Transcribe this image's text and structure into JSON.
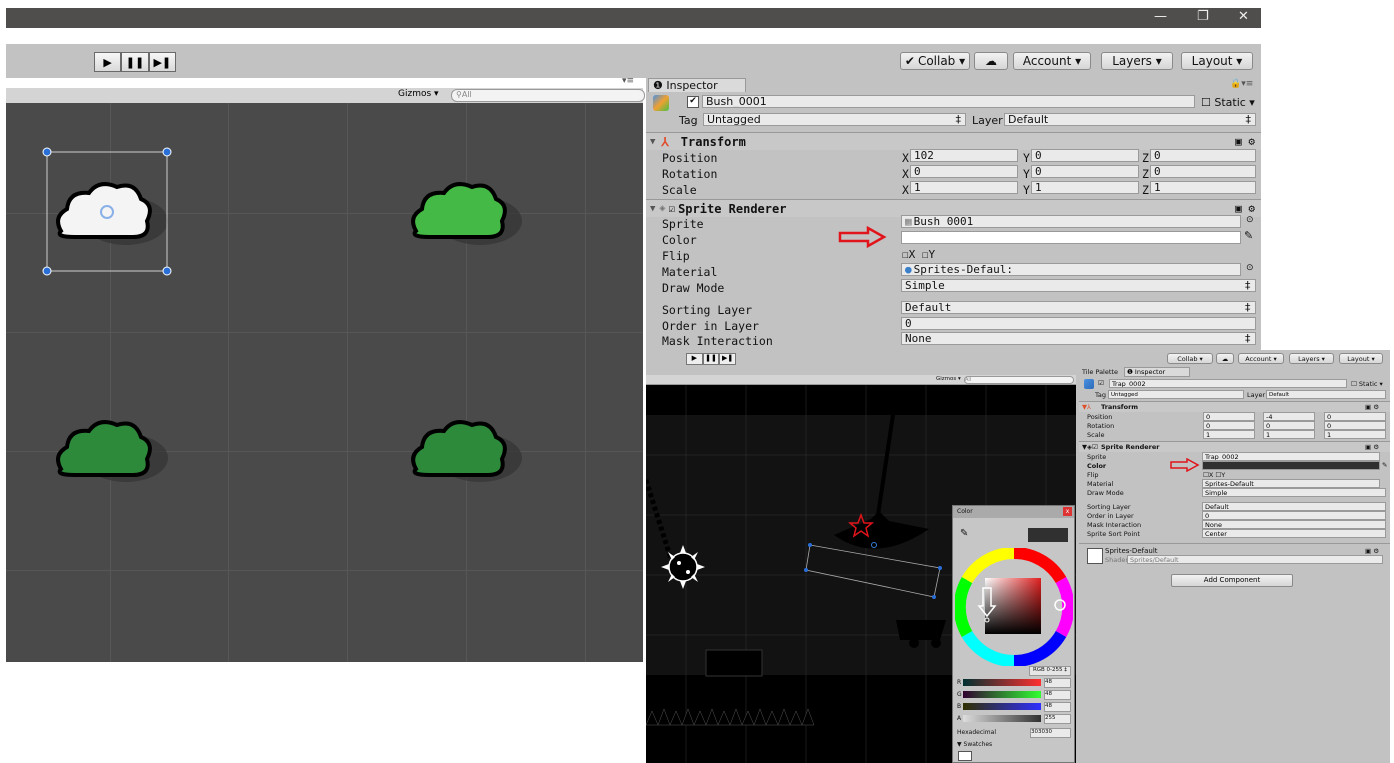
{
  "window_controls": {
    "minimize": "—",
    "restore": "❐",
    "close": "✕"
  },
  "toolbar": {
    "collab": "Collab ▾",
    "account": "Account ▾",
    "layers": "Layers ▾",
    "layout": "Layout ▾"
  },
  "scene": {
    "gizmos": "Gizmos ▾",
    "search_placeholder": "All"
  },
  "inspector": {
    "tab": "Inspector",
    "object_name": "Bush_0001",
    "static_label": "Static ▾",
    "tag_label": "Tag",
    "tag_value": "Untagged",
    "layer_label": "Layer",
    "layer_value": "Default",
    "transform": {
      "title": "Transform",
      "position_label": "Position",
      "pos": {
        "x": "102",
        "y": "0",
        "z": "0"
      },
      "rotation_label": "Rotation",
      "rot": {
        "x": "0",
        "y": "0",
        "z": "0"
      },
      "scale_label": "Scale",
      "scale": {
        "x": "1",
        "y": "1",
        "z": "1"
      }
    },
    "sprite_renderer": {
      "title": "Sprite Renderer",
      "sprite_label": "Sprite",
      "sprite_value": "Bush_0001",
      "color_label": "Color",
      "color_value": "#ffffff",
      "flip_label": "Flip",
      "flip_x": "X",
      "flip_y": "Y",
      "material_label": "Material",
      "material_value": "Sprites-Defaul:",
      "draw_mode_label": "Draw Mode",
      "draw_mode_value": "Simple",
      "sorting_layer_label": "Sorting Layer",
      "sorting_layer_value": "Default",
      "order_label": "Order in Layer",
      "order_value": "0",
      "mask_label": "Mask Interaction",
      "mask_value": "None"
    },
    "axis": {
      "x": "X",
      "y": "Y",
      "z": "Z"
    }
  },
  "second": {
    "toolbar": {
      "collab": "Collab ▾",
      "account": "Account ▾",
      "layers": "Layers ▾",
      "layout": "Layout ▾"
    },
    "gizmos": "Gizmos ▾",
    "search_placeholder": "All",
    "tabs": {
      "tile_palette": "Tile Palette",
      "inspector": "Inspector"
    },
    "object_name": "Trap_0002",
    "static_label": "Static ▾",
    "tag_label": "Tag",
    "tag_value": "Untagged",
    "layer_label": "Layer",
    "layer_value": "Default",
    "transform": {
      "title": "Transform",
      "position_label": "Position",
      "pos": {
        "x": "0",
        "y": "-4",
        "z": "0"
      },
      "rotation_label": "Rotation",
      "rot": {
        "x": "0",
        "y": "0",
        "z": "0"
      },
      "scale_label": "Scale",
      "scale": {
        "x": "1",
        "y": "1",
        "z": "1"
      }
    },
    "sprite_renderer": {
      "title": "Sprite Renderer",
      "sprite_label": "Sprite",
      "sprite_value": "Trap_0002",
      "color_label": "Color",
      "color_value": "#303030",
      "flip_label": "Flip",
      "flip_x": "X",
      "flip_y": "Y",
      "material_label": "Material",
      "material_value": "Sprites-Default",
      "draw_mode_label": "Draw Mode",
      "draw_mode_value": "Simple",
      "sorting_layer_label": "Sorting Layer",
      "sorting_layer_value": "Default",
      "order_label": "Order in Layer",
      "order_value": "0",
      "mask_label": "Mask Interaction",
      "mask_value": "None",
      "sort_point_label": "Sprite Sort Point",
      "sort_point_value": "Center"
    },
    "material": {
      "name": "Sprites-Default",
      "shader_label": "Shader",
      "shader_value": "Sprites/Default"
    },
    "add_component": "Add Component"
  },
  "color_picker": {
    "title": "Color",
    "mode": "RGB 0-255 ‡",
    "r_label": "R",
    "r_value": "48",
    "g_label": "G",
    "g_value": "48",
    "b_label": "B",
    "b_value": "48",
    "a_label": "A",
    "a_value": "255",
    "hex_label": "Hexadecimal",
    "hex_value": "303030",
    "swatches_label": "▼ Swatches",
    "current_color": "#303030"
  }
}
